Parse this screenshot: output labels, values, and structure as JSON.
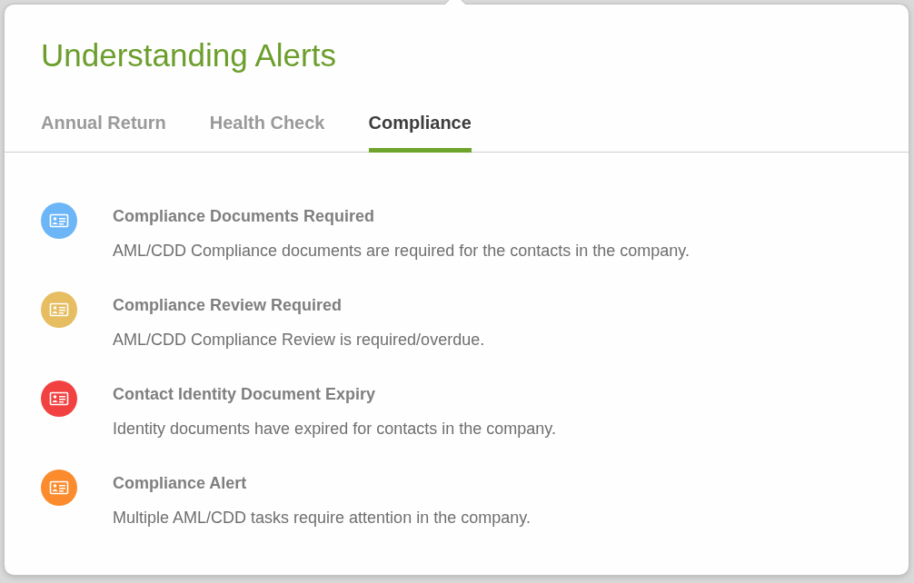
{
  "popover": {
    "title": "Understanding Alerts",
    "tabs": [
      {
        "label": "Annual Return",
        "selected": false
      },
      {
        "label": "Health Check",
        "selected": false
      },
      {
        "label": "Compliance",
        "selected": true
      }
    ],
    "alerts": [
      {
        "title": "Compliance Documents Required",
        "description": "AML/CDD Compliance documents are required for the contacts in the company.",
        "color": "#6cb6f7"
      },
      {
        "title": "Compliance Review Required",
        "description": "AML/CDD Compliance Review is required/overdue.",
        "color": "#e6bd60"
      },
      {
        "title": "Contact Identity Document Expiry",
        "description": "Identity documents have expired for contacts in the company.",
        "color": "#f24141"
      },
      {
        "title": "Compliance Alert",
        "description": "Multiple AML/CDD tasks require attention in the company.",
        "color": "#fb8b2c"
      }
    ]
  }
}
